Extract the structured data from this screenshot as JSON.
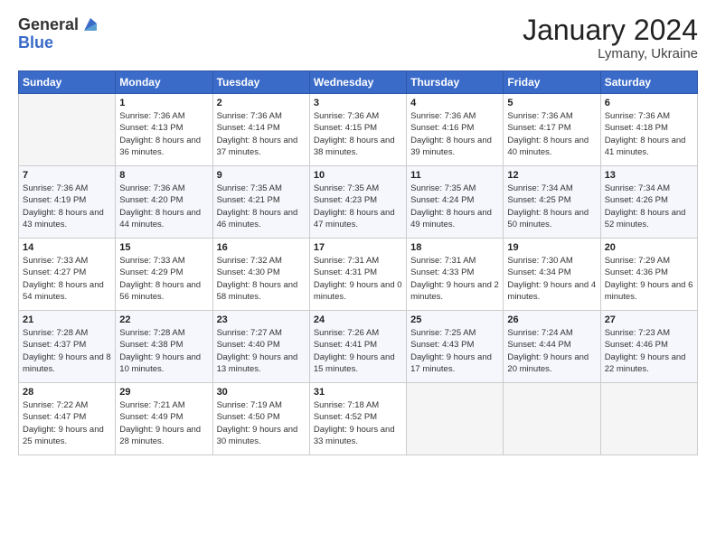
{
  "header": {
    "logo_general": "General",
    "logo_blue": "Blue",
    "month": "January 2024",
    "location": "Lymany, Ukraine"
  },
  "days_of_week": [
    "Sunday",
    "Monday",
    "Tuesday",
    "Wednesday",
    "Thursday",
    "Friday",
    "Saturday"
  ],
  "weeks": [
    [
      {
        "day": "",
        "sunrise": "",
        "sunset": "",
        "daylight": ""
      },
      {
        "day": "1",
        "sunrise": "Sunrise: 7:36 AM",
        "sunset": "Sunset: 4:13 PM",
        "daylight": "Daylight: 8 hours and 36 minutes."
      },
      {
        "day": "2",
        "sunrise": "Sunrise: 7:36 AM",
        "sunset": "Sunset: 4:14 PM",
        "daylight": "Daylight: 8 hours and 37 minutes."
      },
      {
        "day": "3",
        "sunrise": "Sunrise: 7:36 AM",
        "sunset": "Sunset: 4:15 PM",
        "daylight": "Daylight: 8 hours and 38 minutes."
      },
      {
        "day": "4",
        "sunrise": "Sunrise: 7:36 AM",
        "sunset": "Sunset: 4:16 PM",
        "daylight": "Daylight: 8 hours and 39 minutes."
      },
      {
        "day": "5",
        "sunrise": "Sunrise: 7:36 AM",
        "sunset": "Sunset: 4:17 PM",
        "daylight": "Daylight: 8 hours and 40 minutes."
      },
      {
        "day": "6",
        "sunrise": "Sunrise: 7:36 AM",
        "sunset": "Sunset: 4:18 PM",
        "daylight": "Daylight: 8 hours and 41 minutes."
      }
    ],
    [
      {
        "day": "7",
        "sunrise": "Sunrise: 7:36 AM",
        "sunset": "Sunset: 4:19 PM",
        "daylight": "Daylight: 8 hours and 43 minutes."
      },
      {
        "day": "8",
        "sunrise": "Sunrise: 7:36 AM",
        "sunset": "Sunset: 4:20 PM",
        "daylight": "Daylight: 8 hours and 44 minutes."
      },
      {
        "day": "9",
        "sunrise": "Sunrise: 7:35 AM",
        "sunset": "Sunset: 4:21 PM",
        "daylight": "Daylight: 8 hours and 46 minutes."
      },
      {
        "day": "10",
        "sunrise": "Sunrise: 7:35 AM",
        "sunset": "Sunset: 4:23 PM",
        "daylight": "Daylight: 8 hours and 47 minutes."
      },
      {
        "day": "11",
        "sunrise": "Sunrise: 7:35 AM",
        "sunset": "Sunset: 4:24 PM",
        "daylight": "Daylight: 8 hours and 49 minutes."
      },
      {
        "day": "12",
        "sunrise": "Sunrise: 7:34 AM",
        "sunset": "Sunset: 4:25 PM",
        "daylight": "Daylight: 8 hours and 50 minutes."
      },
      {
        "day": "13",
        "sunrise": "Sunrise: 7:34 AM",
        "sunset": "Sunset: 4:26 PM",
        "daylight": "Daylight: 8 hours and 52 minutes."
      }
    ],
    [
      {
        "day": "14",
        "sunrise": "Sunrise: 7:33 AM",
        "sunset": "Sunset: 4:27 PM",
        "daylight": "Daylight: 8 hours and 54 minutes."
      },
      {
        "day": "15",
        "sunrise": "Sunrise: 7:33 AM",
        "sunset": "Sunset: 4:29 PM",
        "daylight": "Daylight: 8 hours and 56 minutes."
      },
      {
        "day": "16",
        "sunrise": "Sunrise: 7:32 AM",
        "sunset": "Sunset: 4:30 PM",
        "daylight": "Daylight: 8 hours and 58 minutes."
      },
      {
        "day": "17",
        "sunrise": "Sunrise: 7:31 AM",
        "sunset": "Sunset: 4:31 PM",
        "daylight": "Daylight: 9 hours and 0 minutes."
      },
      {
        "day": "18",
        "sunrise": "Sunrise: 7:31 AM",
        "sunset": "Sunset: 4:33 PM",
        "daylight": "Daylight: 9 hours and 2 minutes."
      },
      {
        "day": "19",
        "sunrise": "Sunrise: 7:30 AM",
        "sunset": "Sunset: 4:34 PM",
        "daylight": "Daylight: 9 hours and 4 minutes."
      },
      {
        "day": "20",
        "sunrise": "Sunrise: 7:29 AM",
        "sunset": "Sunset: 4:36 PM",
        "daylight": "Daylight: 9 hours and 6 minutes."
      }
    ],
    [
      {
        "day": "21",
        "sunrise": "Sunrise: 7:28 AM",
        "sunset": "Sunset: 4:37 PM",
        "daylight": "Daylight: 9 hours and 8 minutes."
      },
      {
        "day": "22",
        "sunrise": "Sunrise: 7:28 AM",
        "sunset": "Sunset: 4:38 PM",
        "daylight": "Daylight: 9 hours and 10 minutes."
      },
      {
        "day": "23",
        "sunrise": "Sunrise: 7:27 AM",
        "sunset": "Sunset: 4:40 PM",
        "daylight": "Daylight: 9 hours and 13 minutes."
      },
      {
        "day": "24",
        "sunrise": "Sunrise: 7:26 AM",
        "sunset": "Sunset: 4:41 PM",
        "daylight": "Daylight: 9 hours and 15 minutes."
      },
      {
        "day": "25",
        "sunrise": "Sunrise: 7:25 AM",
        "sunset": "Sunset: 4:43 PM",
        "daylight": "Daylight: 9 hours and 17 minutes."
      },
      {
        "day": "26",
        "sunrise": "Sunrise: 7:24 AM",
        "sunset": "Sunset: 4:44 PM",
        "daylight": "Daylight: 9 hours and 20 minutes."
      },
      {
        "day": "27",
        "sunrise": "Sunrise: 7:23 AM",
        "sunset": "Sunset: 4:46 PM",
        "daylight": "Daylight: 9 hours and 22 minutes."
      }
    ],
    [
      {
        "day": "28",
        "sunrise": "Sunrise: 7:22 AM",
        "sunset": "Sunset: 4:47 PM",
        "daylight": "Daylight: 9 hours and 25 minutes."
      },
      {
        "day": "29",
        "sunrise": "Sunrise: 7:21 AM",
        "sunset": "Sunset: 4:49 PM",
        "daylight": "Daylight: 9 hours and 28 minutes."
      },
      {
        "day": "30",
        "sunrise": "Sunrise: 7:19 AM",
        "sunset": "Sunset: 4:50 PM",
        "daylight": "Daylight: 9 hours and 30 minutes."
      },
      {
        "day": "31",
        "sunrise": "Sunrise: 7:18 AM",
        "sunset": "Sunset: 4:52 PM",
        "daylight": "Daylight: 9 hours and 33 minutes."
      },
      {
        "day": "",
        "sunrise": "",
        "sunset": "",
        "daylight": ""
      },
      {
        "day": "",
        "sunrise": "",
        "sunset": "",
        "daylight": ""
      },
      {
        "day": "",
        "sunrise": "",
        "sunset": "",
        "daylight": ""
      }
    ]
  ]
}
